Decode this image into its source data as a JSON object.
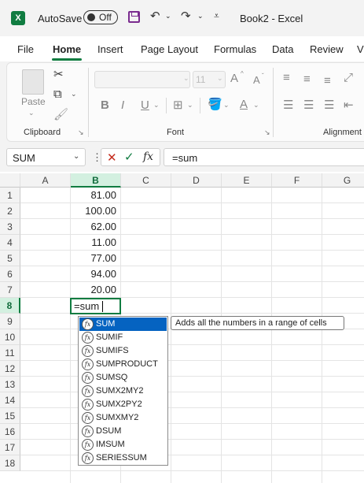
{
  "titlebar": {
    "autosave_label": "AutoSave",
    "autosave_state": "Off",
    "window_title": "Book2 - Excel",
    "logo": "X"
  },
  "ribbon_tabs": [
    "File",
    "Home",
    "Insert",
    "Page Layout",
    "Formulas",
    "Data",
    "Review",
    "V"
  ],
  "ribbon": {
    "clipboard": {
      "label": "Clipboard",
      "paste_label": "Paste"
    },
    "font": {
      "label": "Font",
      "font_size": "11",
      "bold": "B",
      "italic": "I",
      "underline": "U",
      "font_color": "A",
      "grow": "A",
      "shrink": "A"
    },
    "alignment": {
      "label": "Alignment"
    }
  },
  "formula_bar": {
    "name_box": "SUM",
    "dots": "⋮",
    "fx": "fx",
    "formula": "=sum"
  },
  "grid": {
    "columns": [
      "A",
      "B",
      "C",
      "D",
      "E",
      "F",
      "G"
    ],
    "rows": [
      "1",
      "2",
      "3",
      "4",
      "5",
      "6",
      "7",
      "8",
      "9",
      "10",
      "11",
      "12",
      "13",
      "14",
      "15",
      "16",
      "17",
      "18"
    ],
    "col_b_values": [
      "81.00",
      "100.00",
      "62.00",
      "11.00",
      "77.00",
      "94.00",
      "20.00"
    ],
    "active_cell_text": "=sum"
  },
  "autocomplete": {
    "items": [
      "SUM",
      "SUMIF",
      "SUMIFS",
      "SUMPRODUCT",
      "SUMSQ",
      "SUMX2MY2",
      "SUMX2PY2",
      "SUMXMY2",
      "DSUM",
      "IMSUM",
      "SERIESSUM"
    ],
    "selected": "SUM",
    "tooltip": "Adds all the numbers in a range of cells",
    "fx_glyph": "fx"
  },
  "colors": {
    "accent": "#107c41",
    "selection": "#0563c1",
    "save": "#7a2c8f"
  }
}
